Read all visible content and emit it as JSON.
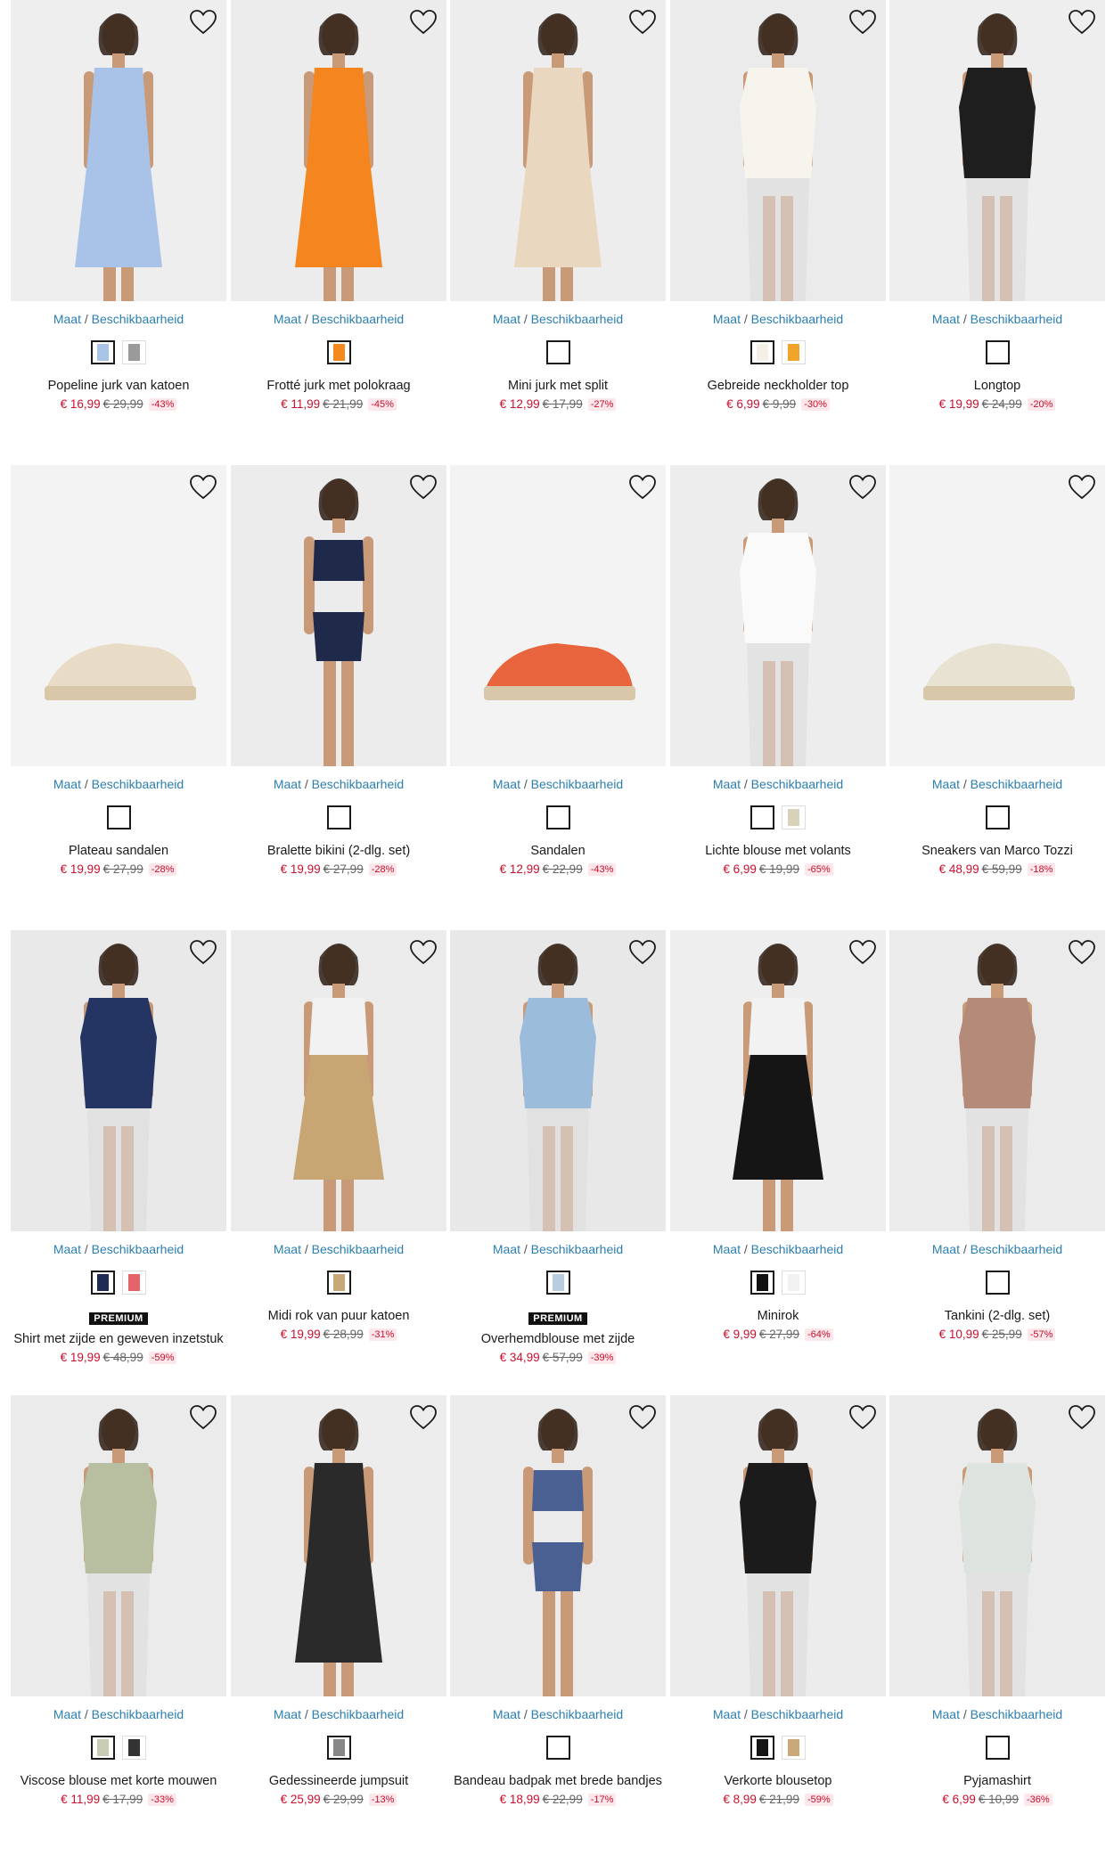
{
  "common": {
    "maat": "Maat",
    "sep": " / ",
    "beschikbaarheid": "Beschikbaarheid",
    "premium": "PREMIUM",
    "wishlist_icon": "heart-outline-icon"
  },
  "products": [
    {
      "name": "Popeline jurk van katoen",
      "price": "€ 16,99",
      "old": "€ 29,99",
      "discount": "-43%",
      "swatches": [
        "#a8c4e6",
        "#9a9a9a"
      ],
      "selected": 0,
      "premium": false,
      "bg": "#eeeeee",
      "figure": "#a9c3e8",
      "figure_type": "dress"
    },
    {
      "name": "Frotté jurk met polokraag",
      "price": "€ 11,99",
      "old": "€ 21,99",
      "discount": "-45%",
      "swatches": [
        "#f28a20"
      ],
      "selected": 0,
      "premium": false,
      "bg": "#ececec",
      "figure": "#f5851f",
      "figure_type": "dress"
    },
    {
      "name": "Mini jurk met split",
      "price": "€ 12,99",
      "old": "€ 17,99",
      "discount": "-27%",
      "swatches": [
        "#ffffff"
      ],
      "selected": 0,
      "premium": false,
      "bg": "#ededed",
      "figure": "#ead7bf",
      "figure_type": "dress"
    },
    {
      "name": "Gebreide neckholder top",
      "price": "€ 6,99",
      "old": "€ 9,99",
      "discount": "-30%",
      "swatches": [
        "#f4f0e6",
        "#f0a52a"
      ],
      "selected": 0,
      "premium": false,
      "bg": "#ebebeb",
      "figure": "#f7f4ee",
      "figure_type": "top"
    },
    {
      "name": "Longtop",
      "price": "€ 19,99",
      "old": "€ 24,99",
      "discount": "-20%",
      "swatches": [
        "#ffffff"
      ],
      "selected": 0,
      "premium": false,
      "bg": "#eeeeee",
      "figure": "#1e1e1e",
      "figure_type": "top"
    },
    {
      "name": "Plateau sandalen",
      "price": "€ 19,99",
      "old": "€ 27,99",
      "discount": "-28%",
      "swatches": [
        "#ffffff"
      ],
      "selected": 0,
      "premium": false,
      "bg": "#f3f3f3",
      "figure": "#e9dcc6",
      "figure_type": "shoe"
    },
    {
      "name": "Bralette bikini (2-dlg. set)",
      "price": "€ 19,99",
      "old": "€ 27,99",
      "discount": "-28%",
      "swatches": [
        "#ffffff"
      ],
      "selected": 0,
      "premium": false,
      "bg": "#ececec",
      "figure": "#1f2a4a",
      "figure_type": "swim"
    },
    {
      "name": "Sandalen",
      "price": "€ 12,99",
      "old": "€ 22,99",
      "discount": "-43%",
      "swatches": [
        "#ffffff"
      ],
      "selected": 0,
      "premium": false,
      "bg": "#f3f3f3",
      "figure": "#e8643c",
      "figure_type": "shoe"
    },
    {
      "name": "Lichte blouse met volants",
      "price": "€ 6,99",
      "old": "€ 19,99",
      "discount": "-65%",
      "swatches": [
        "#ffffff",
        "#d8d2b8"
      ],
      "selected": 0,
      "premium": false,
      "bg": "#ededed",
      "figure": "#fafafa",
      "figure_type": "top"
    },
    {
      "name": "Sneakers van Marco Tozzi",
      "price": "€ 48,99",
      "old": "€ 59,99",
      "discount": "-18%",
      "swatches": [
        "#ffffff"
      ],
      "selected": 0,
      "premium": false,
      "bg": "#f3f3f3",
      "figure": "#e8e2d2",
      "figure_type": "shoe"
    },
    {
      "name": "Shirt met zijde en geweven inzetstuk",
      "price": "€ 19,99",
      "old": "€ 48,99",
      "discount": "-59%",
      "swatches": [
        "#1e2b52",
        "#e5646a"
      ],
      "selected": 0,
      "premium": true,
      "bg": "#e9e9e9",
      "figure": "#243463",
      "figure_type": "top"
    },
    {
      "name": "Midi rok van puur katoen",
      "price": "€ 19,99",
      "old": "€ 28,99",
      "discount": "-31%",
      "swatches": [
        "#c9a877"
      ],
      "selected": 0,
      "premium": false,
      "bg": "#ebebeb",
      "figure": "#c7a674",
      "figure_type": "skirt"
    },
    {
      "name": "Overhemdblouse met zijde",
      "price": "€ 34,99",
      "old": "€ 57,99",
      "discount": "-39%",
      "swatches": [
        "#b8cde0"
      ],
      "selected": 0,
      "premium": true,
      "bg": "#e8e8e8",
      "figure": "#9cbcdc",
      "figure_type": "top"
    },
    {
      "name": "Minirok",
      "price": "€ 9,99",
      "old": "€ 27,99",
      "discount": "-64%",
      "swatches": [
        "#111111",
        "#f2f2f2"
      ],
      "selected": 0,
      "premium": false,
      "bg": "#eeeeee",
      "figure": "#151515",
      "figure_type": "skirt"
    },
    {
      "name": "Tankini (2-dlg. set)",
      "price": "€ 10,99",
      "old": "€ 25,99",
      "discount": "-57%",
      "swatches": [
        "#ffffff"
      ],
      "selected": 0,
      "premium": false,
      "bg": "#ebebeb",
      "figure": "#b48a78",
      "figure_type": "top"
    },
    {
      "name": "Viscose blouse met korte mouwen",
      "price": "€ 11,99",
      "old": "€ 17,99",
      "discount": "-33%",
      "swatches": [
        "#c8ccb4",
        "#333333"
      ],
      "selected": 0,
      "premium": false,
      "bg": "#ebebeb",
      "figure": "#b8bfa0",
      "figure_type": "top"
    },
    {
      "name": "Gedessineerde jumpsuit",
      "price": "€ 25,99",
      "old": "€ 29,99",
      "discount": "-13%",
      "swatches": [
        "#888888"
      ],
      "selected": 0,
      "premium": false,
      "bg": "#ededed",
      "figure": "#2a2a2a",
      "figure_type": "dress"
    },
    {
      "name": "Bandeau badpak met brede bandjes",
      "price": "€ 18,99",
      "old": "€ 22,99",
      "discount": "-17%",
      "swatches": [
        "#ffffff"
      ],
      "selected": 0,
      "premium": false,
      "bg": "#ebebeb",
      "figure": "#4a5f92",
      "figure_type": "swim"
    },
    {
      "name": "Verkorte blousetop",
      "price": "€ 8,99",
      "old": "€ 21,99",
      "discount": "-59%",
      "swatches": [
        "#151515",
        "#c9a87a"
      ],
      "selected": 0,
      "premium": false,
      "bg": "#ececec",
      "figure": "#1b1b1b",
      "figure_type": "top"
    },
    {
      "name": "Pyjamashirt",
      "price": "€ 6,99",
      "old": "€ 10,99",
      "discount": "-36%",
      "swatches": [
        "#ffffff"
      ],
      "selected": 0,
      "premium": false,
      "bg": "#ebebeb",
      "figure": "#dde4df",
      "figure_type": "top"
    }
  ]
}
